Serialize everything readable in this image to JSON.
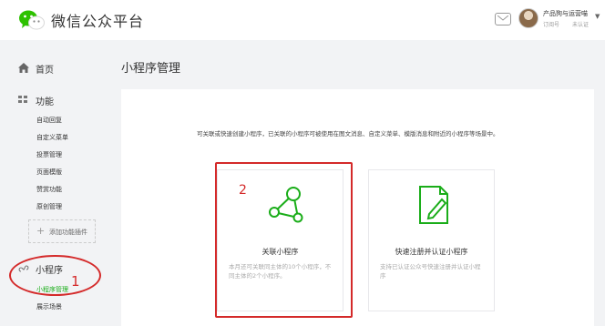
{
  "header": {
    "logo_text": "微信公众平台",
    "account_name": "产品狗与运营喵",
    "account_type": "订阅号",
    "account_status": "未认证"
  },
  "sidebar": {
    "home": "首页",
    "functions": "功能",
    "function_items": [
      "自动回复",
      "自定义菜单",
      "投票管理",
      "页面模版",
      "赞赏功能",
      "原创管理"
    ],
    "add_plugin": "添加功能插件",
    "mini_program": "小程序",
    "mini_program_items": [
      "小程序管理",
      "展示场景"
    ]
  },
  "main": {
    "title": "小程序管理",
    "description": "可关联或快速创建小程序，已关联的小程序可被使用在图文消息、自定义菜单、模版消息和附近的小程序等场景中。",
    "cards": [
      {
        "title": "关联小程序",
        "subtitle": "本月还可关联同主体的10个小程序，不同主体的2个小程序。"
      },
      {
        "title": "快速注册并认证小程序",
        "subtitle": "支持已认证公众号快速注册并认证小程序"
      }
    ]
  },
  "annotations": {
    "marker_1": "1",
    "marker_2": "2"
  },
  "colors": {
    "accent": "#1aad19",
    "annotation": "#d42a2a"
  }
}
